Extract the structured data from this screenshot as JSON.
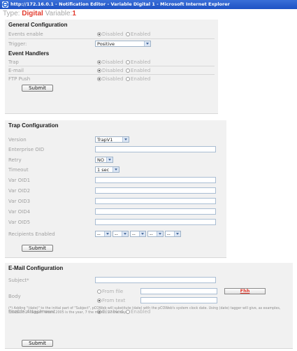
{
  "window": {
    "title": "http://172.16.0.1 - Notification Editor - Variable Digital 1 - Microsoft Internet Explorer"
  },
  "type_line": {
    "type_label": "Type:",
    "type_value": "Digital",
    "variable_label": "Variable:",
    "variable_value": "1"
  },
  "general": {
    "title": "General Configuration",
    "events_enable": {
      "label": "Events enable",
      "options": [
        "Disabled",
        "Enabled"
      ],
      "selected": "Disabled"
    },
    "trigger": {
      "label": "Trigger:",
      "value": "Positive"
    },
    "event_handlers_title": "Event Handlers",
    "handlers": [
      {
        "label": "Trap",
        "options": [
          "Disabled",
          "Enabled"
        ],
        "selected": "Disabled"
      },
      {
        "label": "E-mail",
        "options": [
          "Disabled",
          "Enabled"
        ],
        "selected": "Disabled"
      },
      {
        "label": "FTP Push",
        "options": [
          "Disabled",
          "Enabled"
        ],
        "selected": "Disabled"
      }
    ],
    "submit_label": "Submit"
  },
  "trap": {
    "title": "Trap Configuration",
    "version": {
      "label": "Version",
      "value": "TrapV1"
    },
    "enterprise_oid": {
      "label": "Enterprise OID",
      "value": ""
    },
    "retry": {
      "label": "Retry",
      "value": "NO"
    },
    "timeout": {
      "label": "Timeout",
      "value": "1 sec"
    },
    "var_oids": [
      "Var OID1",
      "Var OID2",
      "Var OID3",
      "Var OID4",
      "Var OID5"
    ],
    "recipients": {
      "label": "Recipients Enabled",
      "values": [
        "--",
        "--",
        "--",
        "--",
        "--"
      ]
    },
    "submit_label": "Submit"
  },
  "email": {
    "title": "E-Mail Configuration",
    "subject": {
      "label": "Subject*",
      "value": ""
    },
    "body": {
      "label": "Body",
      "options": [
        "From file",
        "From text"
      ],
      "selected": "From text",
      "file_button": "Fhh"
    },
    "attachment": {
      "label": "Enable Attachment",
      "options": [
        "Disabled",
        "Enabled"
      ],
      "selected": "Disabled"
    },
    "note": "(*) Adding \"(date)\" to the initial part of \"Subject\", pCOWeb will substitute (date) with the pCOWeb's system clock date. Using (date) tagger will give, as examples, \"2005-07-27 tagger\" where 2005 is the year, 7 the month, 27 the day.",
    "submit_label": "Submit"
  }
}
